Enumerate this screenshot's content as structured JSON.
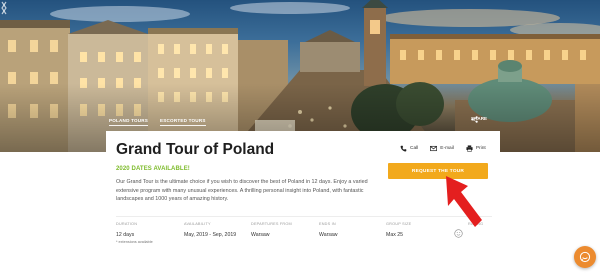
{
  "hero": {
    "tags": [
      "POLAND TOURS",
      "ESCORTED TOURS"
    ],
    "share_label": "SHARE"
  },
  "tour": {
    "title": "Grand Tour of Poland",
    "badge": "2020 DATES AVAILABLE!",
    "description": "Our Grand Tour is the ultimate choice if you wish to discover the best of Poland in 12 days. Enjoy a varied extensive program with many unusual experiences. A thrilling personal insight into Poland, with fantastic landscapes and 1000 years of amazing history."
  },
  "actions": {
    "call": "Call",
    "email": "E-mail",
    "print": "Print"
  },
  "cta": {
    "label": "REQUEST THE TOUR",
    "color": "#f2a91c"
  },
  "facts": [
    {
      "label": "DURATION",
      "value": "12 days",
      "note": "* extensions available"
    },
    {
      "label": "AVAILABILITY",
      "value": "May, 2019 - Sep, 2019"
    },
    {
      "label": "DEPARTURES FROM",
      "value": "Warsaw"
    },
    {
      "label": "ENDS IN",
      "value": "Warsaw"
    },
    {
      "label": "GROUP SIZE",
      "value": "Max 25"
    },
    {
      "label": "RATING",
      "value": ""
    }
  ],
  "colors": {
    "accent_green": "#7dbb2a",
    "arrow_red": "#e41f1f",
    "chat_orange": "#ec8b2f"
  },
  "icons": [
    "chevron-left-icon",
    "chevron-right-icon",
    "share-icon",
    "phone-icon",
    "email-icon",
    "printer-icon",
    "smiley-icon",
    "chat-icon"
  ]
}
